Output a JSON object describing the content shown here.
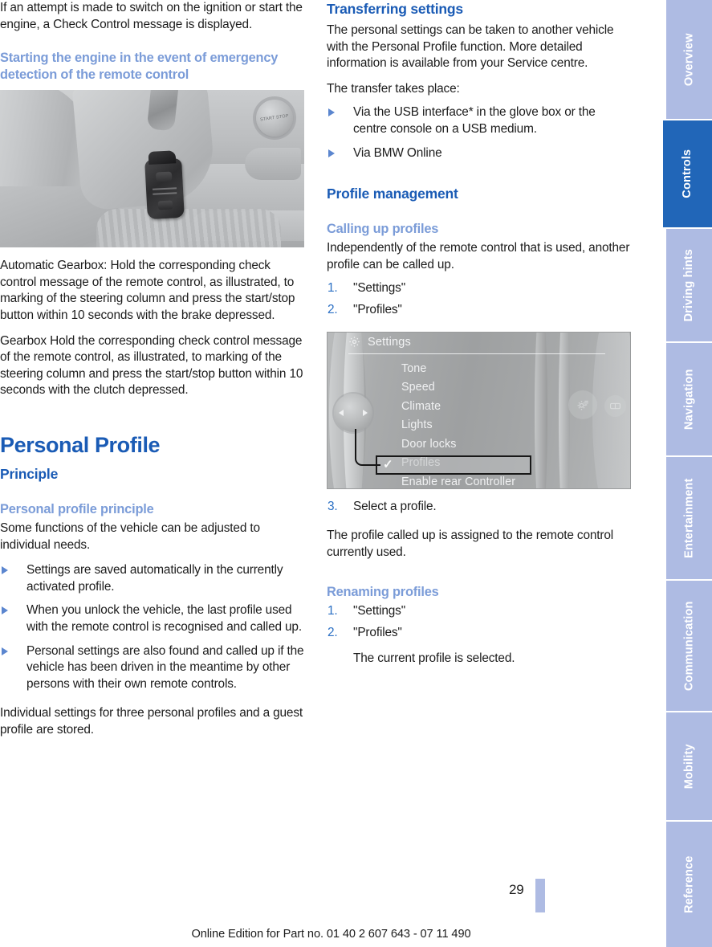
{
  "page": {
    "number": "29",
    "footer_note": "Online Edition for Part no. 01 40 2 607 643 - 07 11 490"
  },
  "left_column": {
    "intro_paragraph": "If an attempt is made to switch on the ignition or start the engine, a Check Control message is displayed.",
    "emergency_heading": "Starting the engine in the event of emergency detection of the remote control",
    "figure_interior": {
      "caption_alt": "Remote control held against the marking of the steering column",
      "start_stop_label": "START STOP"
    },
    "automatic_gearbox_paragraph": "Automatic Gearbox: Hold the corresponding check control message of the remote control, as illustrated, to marking of the steering column and press the start/stop button within 10 seconds with the brake depressed.",
    "manual_gearbox_paragraph": "Gearbox Hold the corresponding check control message of the remote control, as illustrated, to marking of the steering column and press the start/stop button within 10 seconds with the clutch depressed.",
    "chapter_title": "Personal Profile",
    "principle_heading": "Principle",
    "personal_profile_principle_heading": "Personal profile principle",
    "principle_paragraph": "Some functions of the vehicle can be adjusted to individual needs.",
    "principle_bullets": [
      "Settings are saved automatically in the currently activated profile.",
      "When you unlock the vehicle, the last profile used with the remote control is recognised and called up.",
      "Personal settings are also found and called up if the vehicle has been driven in the meantime by other persons with their own remote controls."
    ],
    "closing_paragraph": "Individual settings for three personal profiles and a guest profile are stored."
  },
  "right_column": {
    "transferring_heading": "Transferring settings",
    "transferring_paragraph": "The personal settings can be taken to another vehicle with the Personal Profile function. More detailed information is available from your Service centre.",
    "transfer_intro": "The transfer takes place:",
    "transfer_bullets": [
      "Via the USB interface* in the glove box or the centre console on a USB medium.",
      "Via BMW Online"
    ],
    "profile_management_heading": "Profile management",
    "calling_up_heading": "Calling up profiles",
    "calling_up_paragraph": "Independently of the remote control that is used, another profile can be called up.",
    "calling_up_steps": [
      {
        "num": "1.",
        "text": "\"Settings\""
      },
      {
        "num": "2.",
        "text": "\"Profiles\""
      }
    ],
    "idrive_screen": {
      "title": "Settings",
      "gear_icon": "gear-icon",
      "items": [
        "Tone",
        "Speed",
        "Climate",
        "Lights",
        "Door locks",
        "Profiles",
        "Enable rear Controller"
      ],
      "highlighted_item": "Profiles",
      "checkmark": "✓"
    },
    "select_step": {
      "num": "3.",
      "text": "Select a profile."
    },
    "assigned_paragraph": "The profile called up is assigned to the remote control currently used.",
    "renaming_heading": "Renaming profiles",
    "renaming_steps": [
      {
        "num": "1.",
        "text": "\"Settings\""
      },
      {
        "num": "2.",
        "text": "\"Profiles\""
      }
    ],
    "renaming_note": "The current profile is selected."
  },
  "sidebar": {
    "tabs": [
      {
        "label": "Overview",
        "active": false
      },
      {
        "label": "Controls",
        "active": true
      },
      {
        "label": "Driving hints",
        "active": false
      },
      {
        "label": "Navigation",
        "active": false
      },
      {
        "label": "Entertainment",
        "active": false
      },
      {
        "label": "Communication",
        "active": false
      },
      {
        "label": "Mobility",
        "active": false
      },
      {
        "label": "Reference",
        "active": false
      }
    ]
  },
  "colors": {
    "heading_blue": "#1a5bb5",
    "subheading_blue": "#7b9cd8",
    "tab_inactive": "#aebbe3",
    "tab_active": "#2166b8",
    "body_text": "#1c1c1c"
  }
}
